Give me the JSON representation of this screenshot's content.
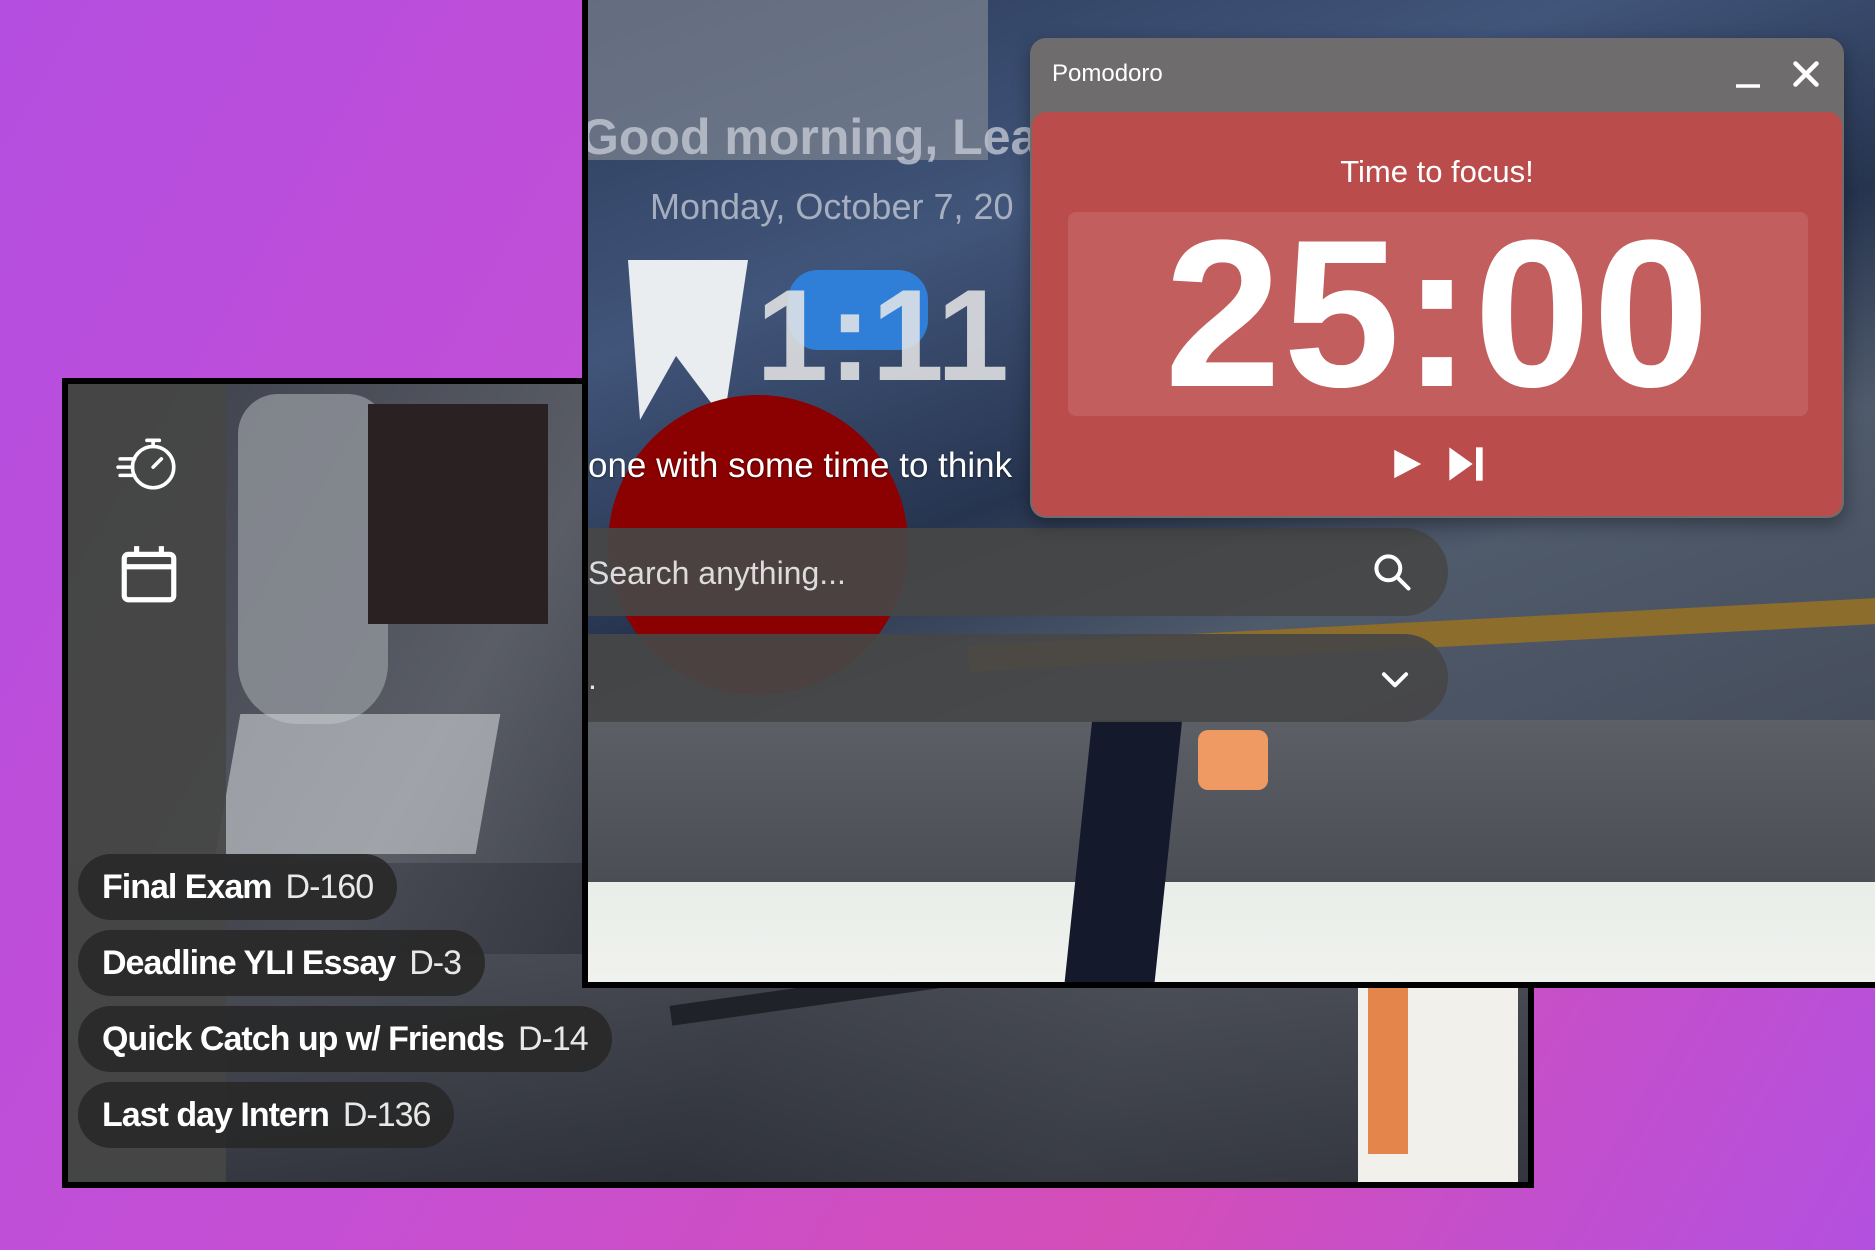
{
  "sidebar": {
    "icons": [
      "timer-icon",
      "calendar-icon"
    ]
  },
  "countdowns": [
    {
      "title": "Final Exam",
      "days": "D-160"
    },
    {
      "title": "Deadline YLI Essay",
      "days": "D-3"
    },
    {
      "title": "Quick Catch up w/ Friends",
      "days": "D-14"
    },
    {
      "title": "Last day Intern",
      "days": "D-136"
    }
  ],
  "home": {
    "greeting": "Good morning, Learn",
    "date": "Monday, October 7, 20",
    "clock": "1:11",
    "quote": "one with some time to think",
    "search_placeholder": "Search anything...",
    "dropdown_value": "."
  },
  "pomodoro": {
    "title": "Pomodoro",
    "message": "Time to focus!",
    "timer": "25:00",
    "accent": "#bb4c4c"
  }
}
